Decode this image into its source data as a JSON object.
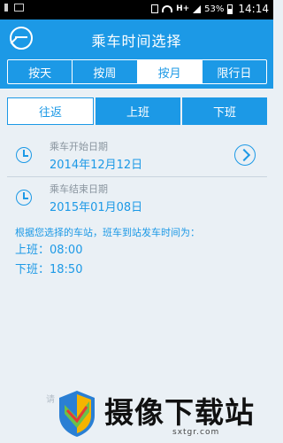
{
  "status_bar": {
    "network": "H+",
    "battery_percent": "53%",
    "time": "14:14"
  },
  "header": {
    "title": "乘车时间选择"
  },
  "tabs": [
    {
      "label": "按天",
      "active": false
    },
    {
      "label": "按周",
      "active": false
    },
    {
      "label": "按月",
      "active": true
    },
    {
      "label": "限行日",
      "active": false
    }
  ],
  "segments": [
    {
      "label": "往返",
      "active": true
    },
    {
      "label": "上班",
      "active": false
    },
    {
      "label": "下班",
      "active": false
    }
  ],
  "start_date": {
    "label": "乘车开始日期",
    "value": "2014年12月12日"
  },
  "end_date": {
    "label": "乘车结束日期",
    "value": "2015年01月08日"
  },
  "info": {
    "line": "根据您选择的车站，班车到站发车时间为：",
    "to_work": "上班：08:00",
    "off_work": "下班：18:50"
  },
  "hint": {
    "text": "请"
  },
  "watermark": {
    "name": "摄像下载站",
    "url": "sxtgr.com"
  },
  "colors": {
    "accent": "#1c99e6",
    "background": "#eaf0f5"
  }
}
